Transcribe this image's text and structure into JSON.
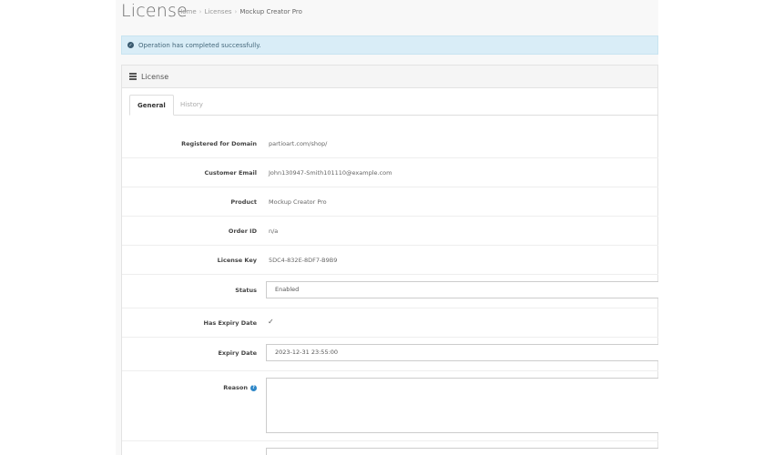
{
  "header": {
    "title": "License",
    "breadcrumb": [
      "Home",
      "Licenses",
      "Mockup Creator Pro"
    ]
  },
  "alert": {
    "message": "Operation has completed successfully.",
    "icon": "check-circle-icon"
  },
  "panel": {
    "title": "License",
    "icon": "list-icon"
  },
  "tabs": [
    {
      "label": "General",
      "active": true
    },
    {
      "label": "History",
      "active": false
    }
  ],
  "form": {
    "registered_domain": {
      "label": "Registered for Domain",
      "value": "partioart.com/shop/"
    },
    "customer_email": {
      "label": "Customer Email",
      "value": "John130947-Smith101110@example.com"
    },
    "product": {
      "label": "Product",
      "value": "Mockup Creator Pro"
    },
    "order_id": {
      "label": "Order ID",
      "value": "n/a"
    },
    "license_key": {
      "label": "License Key",
      "value": "5DC4-832E-8DF7-B9B9"
    },
    "status": {
      "label": "Status",
      "value": "Enabled"
    },
    "has_expiry_date": {
      "label": "Has Expiry Date",
      "checked": true
    },
    "expiry_date": {
      "label": "Expiry Date",
      "value": "2023-12-31 23:55:00"
    },
    "reason": {
      "label": "Reason",
      "value": ""
    }
  },
  "colors": {
    "alert_bg": "#d9edf7",
    "help_icon": "#2e87c8",
    "page_bg": "#f8f8f8"
  }
}
